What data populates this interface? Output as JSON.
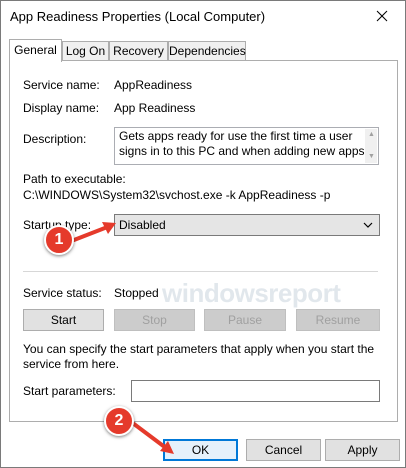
{
  "window": {
    "title": "App Readiness Properties (Local Computer)"
  },
  "tabs": [
    {
      "label": "General",
      "active": true
    },
    {
      "label": "Log On",
      "active": false
    },
    {
      "label": "Recovery",
      "active": false
    },
    {
      "label": "Dependencies",
      "active": false
    }
  ],
  "general": {
    "service_name_label": "Service name:",
    "service_name_value": "AppReadiness",
    "display_name_label": "Display name:",
    "display_name_value": "App Readiness",
    "description_label": "Description:",
    "description_value": "Gets apps ready for use the first time a user signs in to this PC and when adding new apps.",
    "path_label": "Path to executable:",
    "path_value": "C:\\WINDOWS\\System32\\svchost.exe -k AppReadiness -p",
    "startup_type_label": "Startup type:",
    "startup_type_value": "Disabled",
    "service_status_label": "Service status:",
    "service_status_value": "Stopped",
    "buttons": {
      "start": "Start",
      "stop": "Stop",
      "pause": "Pause",
      "resume": "Resume"
    },
    "start_params_text": "You can specify the start parameters that apply when you start the service from here.",
    "start_params_label": "Start parameters:",
    "start_params_value": ""
  },
  "dialog_buttons": {
    "ok": "OK",
    "cancel": "Cancel",
    "apply": "Apply"
  },
  "annotations": [
    {
      "number": "1"
    },
    {
      "number": "2"
    }
  ],
  "watermark": "windowsreport",
  "colors": {
    "badge": "#e53a2b",
    "focus_border": "#0078d7"
  }
}
